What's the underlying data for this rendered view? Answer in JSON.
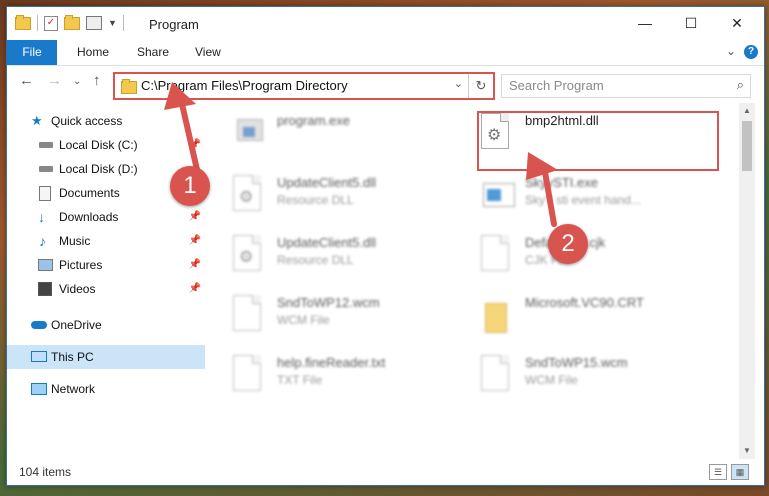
{
  "window": {
    "title": "Program",
    "controls": {
      "minimize": "—",
      "maximize": "☐",
      "close": "✕"
    }
  },
  "ribbon": {
    "tabs": [
      "File",
      "Home",
      "Share",
      "View"
    ],
    "help_icon": "?"
  },
  "address_bar": {
    "path": "C:\\Program Files\\Program Directory",
    "search_placeholder": "Search Program"
  },
  "sidebar": {
    "items": [
      {
        "label": "Quick access",
        "icon": "star-icon",
        "pinned": false
      },
      {
        "label": "Local Disk (C:)",
        "icon": "drive-icon",
        "pinned": true
      },
      {
        "label": "Local Disk (D:)",
        "icon": "drive-icon",
        "pinned": true
      },
      {
        "label": "Documents",
        "icon": "documents-icon",
        "pinned": true
      },
      {
        "label": "Downloads",
        "icon": "downloads-icon",
        "pinned": true
      },
      {
        "label": "Music",
        "icon": "music-icon",
        "pinned": true
      },
      {
        "label": "Pictures",
        "icon": "pictures-icon",
        "pinned": true
      },
      {
        "label": "Videos",
        "icon": "videos-icon",
        "pinned": true
      },
      {
        "label": "OneDrive",
        "icon": "onedrive-icon",
        "pinned": false
      },
      {
        "label": "This PC",
        "icon": "pc-icon",
        "pinned": false,
        "selected": true
      },
      {
        "label": "Network",
        "icon": "network-icon",
        "pinned": false
      }
    ]
  },
  "files": [
    {
      "name": "program.exe",
      "type": "",
      "icon": "program-exe-icon"
    },
    {
      "name": "bmp2html.dll",
      "type": "",
      "icon": "dll-gear-icon"
    },
    {
      "name": "UpdateClient5.dll",
      "type": "Resource DLL",
      "icon": "dll-gear-icon"
    },
    {
      "name": "SkyySTI.exe",
      "type": "SkyY sti event hand...",
      "icon": "exe-window-icon"
    },
    {
      "name": "UpdateClient5.dll",
      "type": "Resource DLL",
      "icon": "dll-gear-icon"
    },
    {
      "name": "DefaultSet.cjk",
      "type": "CJK File",
      "icon": "document-icon"
    },
    {
      "name": "SndToWP12.wcm",
      "type": "WCM File",
      "icon": "document-icon"
    },
    {
      "name": "Microsoft.VC90.CRT",
      "type": "",
      "icon": "folder-icon"
    },
    {
      "name": "help.fineReader.txt",
      "type": "TXT File",
      "icon": "document-icon"
    },
    {
      "name": "SndToWP15.wcm",
      "type": "WCM File",
      "icon": "document-icon"
    }
  ],
  "status": {
    "item_count": "104 items"
  },
  "annotations": [
    {
      "number": "1",
      "color": "#d9534f"
    },
    {
      "number": "2",
      "color": "#d9534f"
    }
  ],
  "colors": {
    "accent": "#1979ca",
    "annotation": "#d9534f",
    "selection": "#cce4f7"
  }
}
